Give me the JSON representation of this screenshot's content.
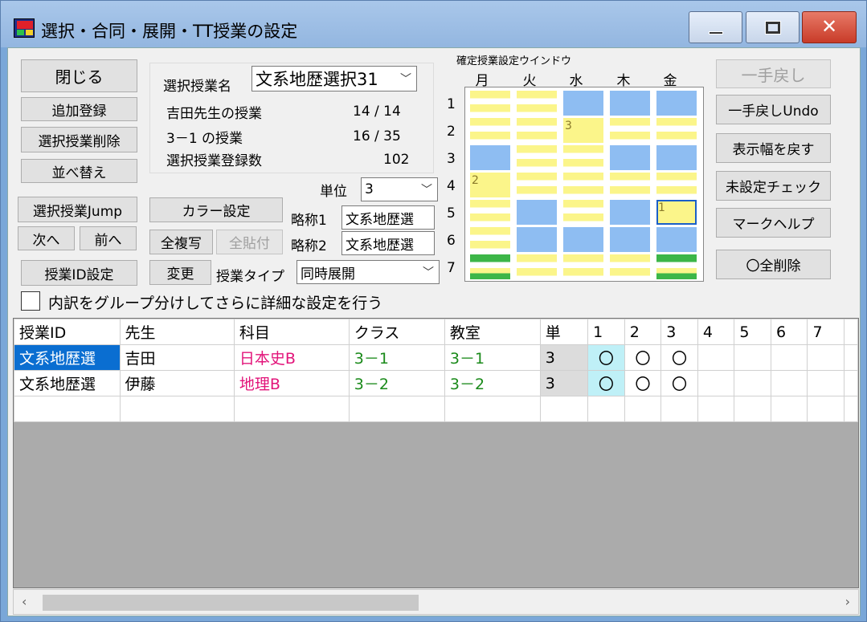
{
  "window": {
    "title": "選択・合同・展開・TT授業の設定",
    "close_glyph": "✕"
  },
  "left_buttons": {
    "close": "閉じる",
    "add": "追加登録",
    "delete": "選択授業削除",
    "sort": "並べ替え",
    "jump": "選択授業Jump",
    "next": "次へ",
    "prev": "前へ",
    "id_setting": "授業ID設定"
  },
  "info": {
    "selected_label": "選択授業名",
    "selected_value": "文系地歴選択31",
    "teacher_label": "吉田先生の授業",
    "teacher_value": "14 / 14",
    "class_label": "3－1 の授業",
    "class_value": "16 / 35",
    "count_label": "選択授業登録数",
    "count_value": "102"
  },
  "mid": {
    "color_button": "カラー設定",
    "copy_all": "全複写",
    "paste_all": "全貼付",
    "change": "変更",
    "unit_label": "単位",
    "unit_value": "3",
    "abbr1_label": "略称1",
    "abbr1_value": "文系地歴選",
    "abbr2_label": "略称2",
    "abbr2_value": "文系地歴選",
    "type_label": "授業タイプ",
    "type_value": "同時展開"
  },
  "grid": {
    "title": "確定授業設定ウインドウ",
    "days": [
      "月",
      "火",
      "水",
      "木",
      "金"
    ],
    "periods": [
      "1",
      "2",
      "3",
      "4",
      "5",
      "6",
      "7"
    ],
    "colors": {
      "yellow": "#fbf58a",
      "blue": "#8ebdf2",
      "green": "#3cb648",
      "white": "#ffffff",
      "highlight": "#1a5fc8"
    },
    "cells": [
      [
        "stripe",
        "stripe",
        "blue",
        "blue",
        "blue"
      ],
      [
        "stripe",
        "stripe",
        "yellow",
        "stripe",
        "stripe"
      ],
      [
        "blue",
        "stripe",
        "stripe",
        "blue",
        "blue"
      ],
      [
        "yellow",
        "stripe",
        "stripe",
        "stripe",
        "stripe"
      ],
      [
        "stripe",
        "blue",
        "stripe",
        "blue",
        "yellow"
      ],
      [
        "stripe",
        "blue",
        "blue",
        "blue",
        "blue"
      ],
      [
        "green",
        "stripe",
        "stripe",
        "stripe",
        "green"
      ]
    ],
    "labels": {
      "1-2": "3",
      "3-0": "2",
      "4-4": "1"
    }
  },
  "right_buttons": {
    "undo": "一手戻し",
    "redo": "一手戻しUndo",
    "reset_width": "表示幅を戻す",
    "unset_check": "未設定チェック",
    "mark_help": "マークヘルプ",
    "clear_all": "〇全削除"
  },
  "group_option": "内訳をグループ分けしてさらに詳細な設定を行う",
  "table": {
    "headers": [
      "授業ID",
      "先生",
      "科目",
      "クラス",
      "教室",
      "単",
      "1",
      "2",
      "3",
      "4",
      "5",
      "6",
      "7"
    ],
    "rows": [
      [
        "文系地歴選",
        "吉田",
        "日本史B",
        "3－1",
        "3－1",
        "3",
        "〇",
        "〇",
        "〇",
        "",
        "",
        "",
        ""
      ],
      [
        "文系地歴選",
        "伊藤",
        "地理B",
        "3－2",
        "3－2",
        "3",
        "〇",
        "〇",
        "〇",
        "",
        "",
        "",
        ""
      ]
    ]
  },
  "scroll": {
    "left": "‹",
    "right": "›"
  }
}
